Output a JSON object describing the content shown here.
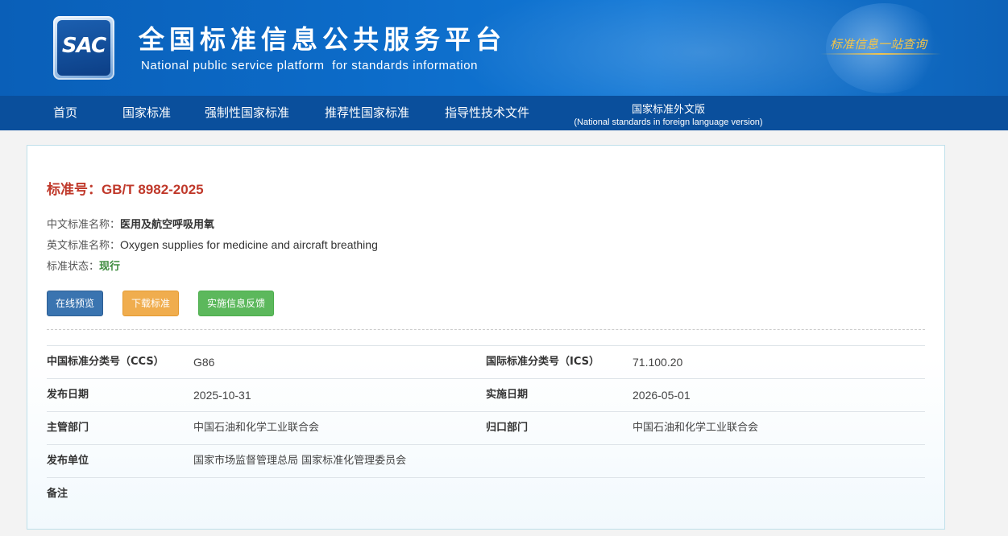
{
  "header": {
    "logo_text": "SAC",
    "title": "全国标准信息公共服务平台",
    "subtitle": "National public service platform  for standards information",
    "slogan": "标准信息一站查询"
  },
  "nav": {
    "items": [
      {
        "label": "首页"
      },
      {
        "label": "国家标准"
      },
      {
        "label": "强制性国家标准"
      },
      {
        "label": "推荐性国家标准"
      },
      {
        "label": "指导性技术文件"
      }
    ],
    "foreign": {
      "line1": "国家标准外文版",
      "line2": "(National standards in foreign language version)"
    }
  },
  "standard": {
    "number_label": "标准号：",
    "number": "GB/T 8982-2025",
    "cn_name_label": "中文标准名称：",
    "cn_name": "医用及航空呼吸用氧",
    "en_name_label": "英文标准名称：",
    "en_name": "Oxygen supplies for medicine and aircraft breathing",
    "status_label": "标准状态：",
    "status": "现行"
  },
  "buttons": {
    "preview": "在线预览",
    "download": "下载标准",
    "feedback": "实施信息反馈"
  },
  "details": {
    "ccs_label": "中国标准分类号（CCS）",
    "ccs": "G86",
    "ics_label": "国际标准分类号（ICS）",
    "ics": "71.100.20",
    "publish_date_label": "发布日期",
    "publish_date": "2025-10-31",
    "implement_date_label": "实施日期",
    "implement_date": "2026-05-01",
    "competent_dept_label": "主管部门",
    "competent_dept": "中国石油和化学工业联合会",
    "centralized_dept_label": "归口部门",
    "centralized_dept": "中国石油和化学工业联合会",
    "publisher_label": "发布单位",
    "publisher": "国家市场监督管理总局 国家标准化管理委员会",
    "remarks_label": "备注"
  },
  "colors": {
    "header_blue": "#0c6bc8",
    "nav_blue": "#0a4f9c",
    "std_no_red": "#c0392b",
    "status_green": "#3c8a3c",
    "btn_blue": "#3a74b0",
    "btn_orange": "#f0ad4e",
    "btn_green": "#5cb85c"
  }
}
